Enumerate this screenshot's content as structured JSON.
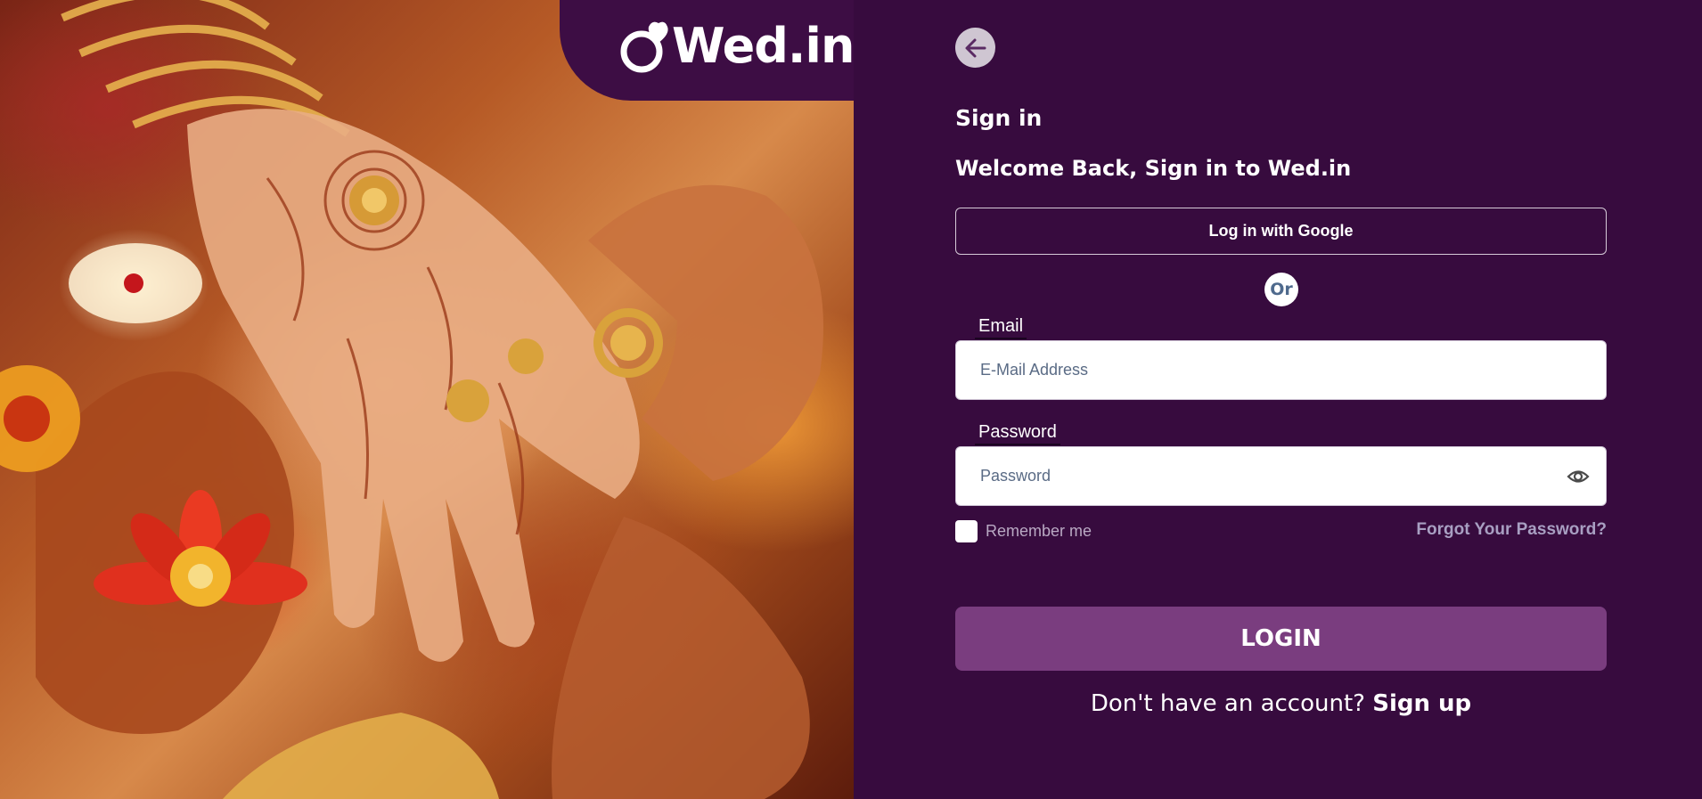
{
  "brand": {
    "logo_text": "Wed.in",
    "accent": "#7a3d7f",
    "background": "#370b3e"
  },
  "hero": {
    "image": "mehndi-hands-ring-ceremony"
  },
  "header": {
    "back_icon": "arrow-left-icon"
  },
  "auth": {
    "title": "Sign in",
    "subtitle": "Welcome Back, Sign in to Wed.in",
    "google_button": "Log in with Google",
    "divider": "Or",
    "email": {
      "label": "Email",
      "placeholder": "E-Mail Address",
      "value": ""
    },
    "password": {
      "label": "Password",
      "placeholder": "Password",
      "value": "",
      "toggle_icon": "eye-icon"
    },
    "remember_me": {
      "label": "Remember me",
      "checked": false
    },
    "forgot_link": "Forgot Your Password?",
    "login_button": "LOGIN",
    "signup_prompt": "Don't have an account?",
    "signup_link": "Sign up"
  }
}
